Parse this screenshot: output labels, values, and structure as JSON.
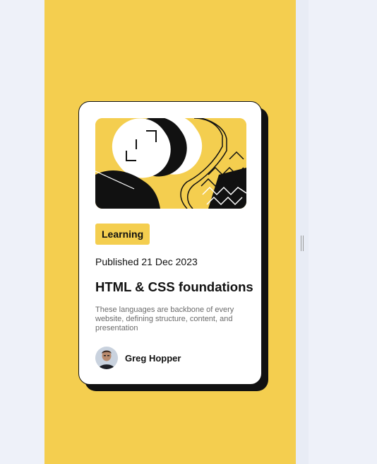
{
  "card": {
    "image_icon": "abstract-illustration",
    "tag_label": "Learning",
    "published": "Published 21 Dec 2023",
    "title": "HTML & CSS foundations",
    "description": "These languages are backbone of every website, defining structure, content, and presentation",
    "author": {
      "name": "Greg Hopper",
      "avatar_icon": "avatar"
    }
  },
  "colors": {
    "accent": "#f4ce4f",
    "ink": "#111111",
    "page_background": "#eef1f9",
    "muted_text": "#6b6b6b"
  }
}
